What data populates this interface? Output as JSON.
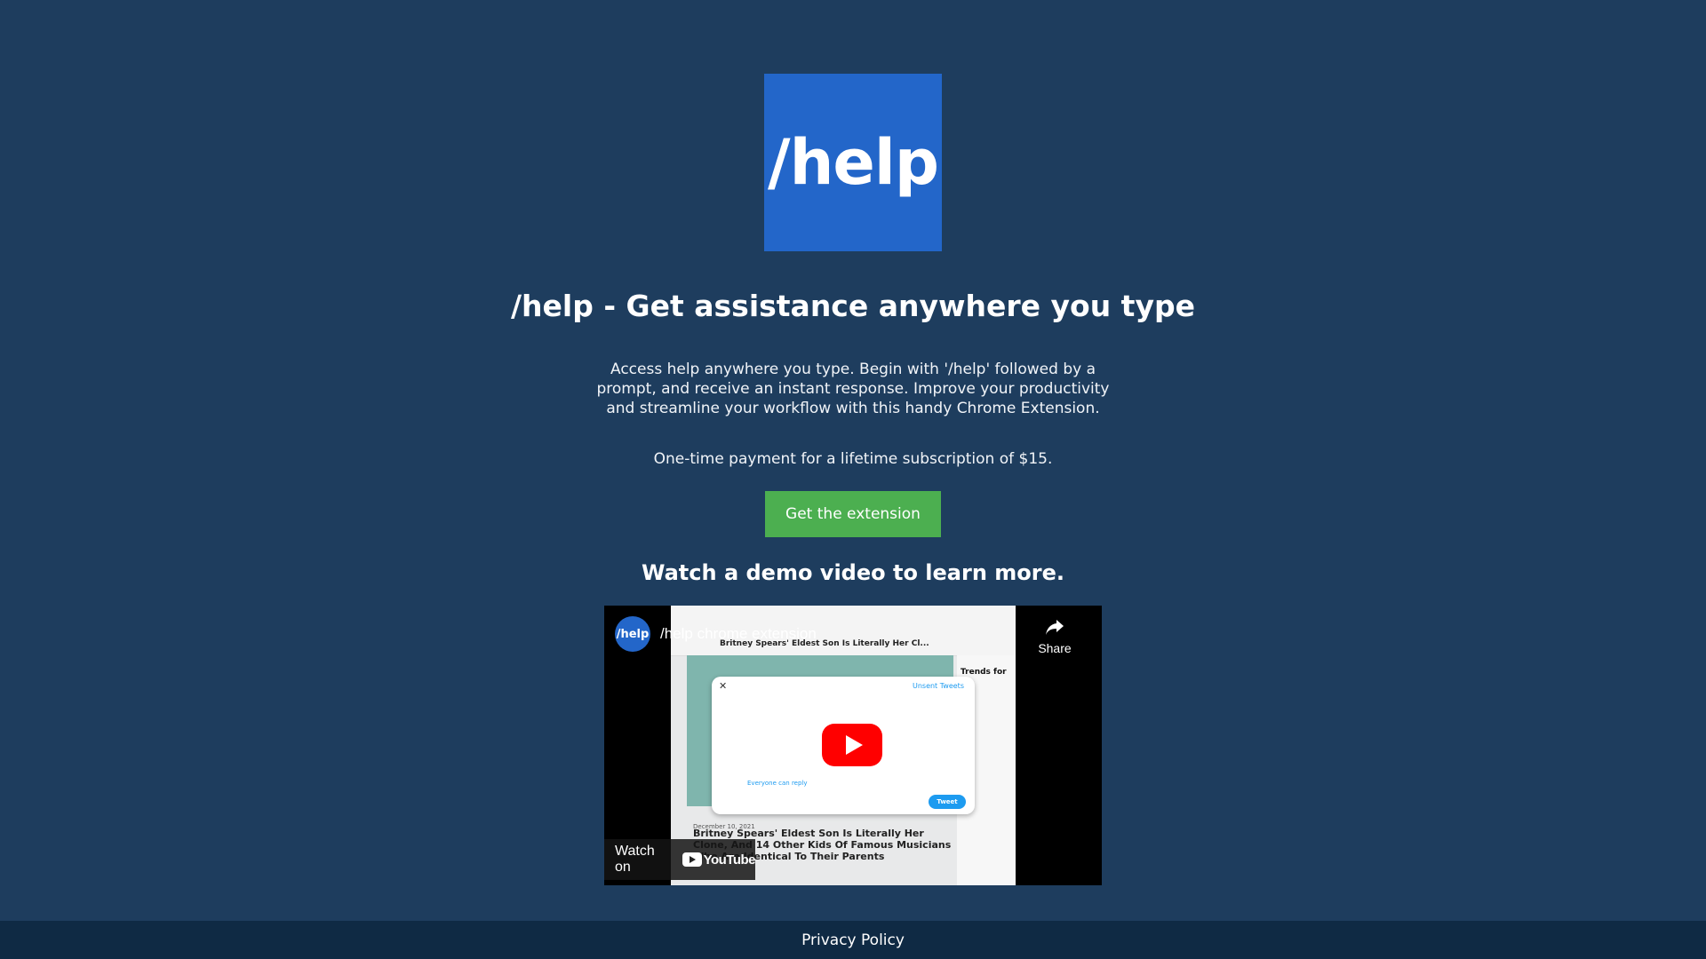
{
  "logo": {
    "text": "/help"
  },
  "hero": {
    "title": "/help - Get assistance anywhere you type",
    "description": "Access help anywhere you type. Begin with '/help' followed by a prompt, and receive an instant response. Improve your productivity and streamline your workflow with this handy Chrome Extension.",
    "price_text": "One-time payment for a lifetime subscription of $15.",
    "cta_label": "Get the extension"
  },
  "demo": {
    "heading": "Watch a demo video to learn more.",
    "video": {
      "channel_avatar_text": "/help",
      "title": "/help chrome extension",
      "share_label": "Share",
      "watch_on_label": "Watch on",
      "youtube_wordmark": "YouTube",
      "thumbnail": {
        "tab_title": "Britney Spears' Eldest Son Is Literally Her Cl...",
        "trends_heading": "Trends for",
        "unsent_tweets": "Unsent Tweets",
        "everyone_can_reply": "Everyone can reply",
        "tweet_button": "Tweet",
        "date": "December 10, 2021",
        "article_headline": "Britney Spears' Eldest Son Is Literally Her Clone, And 14 Other Kids Of Famous Musicians Who Are Identical To Their Parents"
      }
    }
  },
  "footer": {
    "privacy_label": "Privacy Policy"
  },
  "colors": {
    "background": "#1e3d5e",
    "logo_bg": "#2366c9",
    "cta_bg": "#4caf50",
    "footer_bg": "#0f2a44",
    "youtube_red": "#ff0000"
  }
}
